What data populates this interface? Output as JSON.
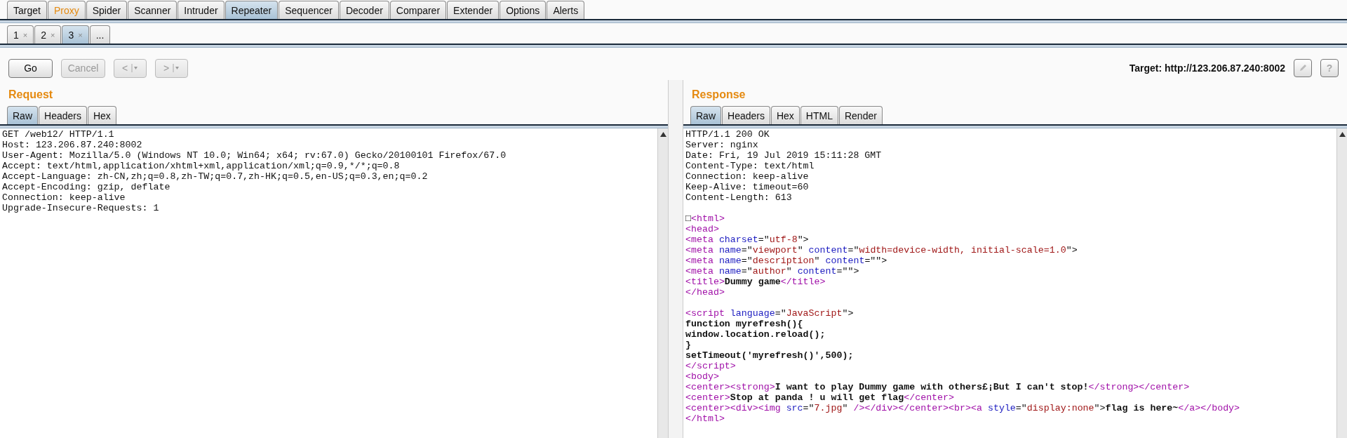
{
  "tabs": [
    {
      "label": "Target",
      "selected": false,
      "highlighted": false
    },
    {
      "label": "Proxy",
      "selected": false,
      "highlighted": true
    },
    {
      "label": "Spider",
      "selected": false,
      "highlighted": false
    },
    {
      "label": "Scanner",
      "selected": false,
      "highlighted": false
    },
    {
      "label": "Intruder",
      "selected": false,
      "highlighted": false
    },
    {
      "label": "Repeater",
      "selected": true,
      "highlighted": false
    },
    {
      "label": "Sequencer",
      "selected": false,
      "highlighted": false
    },
    {
      "label": "Decoder",
      "selected": false,
      "highlighted": false
    },
    {
      "label": "Comparer",
      "selected": false,
      "highlighted": false
    },
    {
      "label": "Extender",
      "selected": false,
      "highlighted": false
    },
    {
      "label": "Options",
      "selected": false,
      "highlighted": false
    },
    {
      "label": "Alerts",
      "selected": false,
      "highlighted": false
    }
  ],
  "repeater_tabs": [
    {
      "label": "1",
      "close": "×",
      "selected": false
    },
    {
      "label": "2",
      "close": "×",
      "selected": false
    },
    {
      "label": "3",
      "close": "×",
      "selected": true
    }
  ],
  "new_tab": "...",
  "toolbar": {
    "buttons": [
      {
        "label": "Go",
        "kind": "plain",
        "disabled": false
      },
      {
        "label": "Cancel",
        "kind": "plain",
        "disabled": true
      },
      {
        "label": "<",
        "kind": "history",
        "disabled": true
      },
      {
        "label": ">",
        "kind": "history",
        "disabled": true
      }
    ],
    "target": "Target: http://123.206.87.240:8002",
    "help": "?"
  },
  "request": {
    "title": "Request",
    "tabs": [
      {
        "label": "Raw",
        "selected": true
      },
      {
        "label": "Headers",
        "selected": false
      },
      {
        "label": "Hex",
        "selected": false
      }
    ],
    "lines": [
      "GET /web12/ HTTP/1.1",
      "Host: 123.206.87.240:8002",
      "User-Agent: Mozilla/5.0 (Windows NT 10.0; Win64; x64; rv:67.0) Gecko/20100101 Firefox/67.0",
      "Accept: text/html,application/xhtml+xml,application/xml;q=0.9,*/*;q=0.8",
      "Accept-Language: zh-CN,zh;q=0.8,zh-TW;q=0.7,zh-HK;q=0.5,en-US;q=0.3,en;q=0.2",
      "Accept-Encoding: gzip, deflate",
      "Connection: keep-alive",
      "Upgrade-Insecure-Requests: 1"
    ]
  },
  "response": {
    "title": "Response",
    "tabs": [
      {
        "label": "Raw",
        "selected": true
      },
      {
        "label": "Headers",
        "selected": false
      },
      {
        "label": "Hex",
        "selected": false
      },
      {
        "label": "HTML",
        "selected": false
      },
      {
        "label": "Render",
        "selected": false
      }
    ],
    "blocks": [
      {
        "lines": [
          [
            {
              "kind": "plain",
              "text": "HTTP/1.1 200 OK"
            }
          ],
          [
            {
              "kind": "plain",
              "text": "Server: nginx"
            }
          ],
          [
            {
              "kind": "plain",
              "text": "Date: Fri, 19 Jul 2019 15:11:28 GMT"
            }
          ],
          [
            {
              "kind": "plain",
              "text": "Content-Type: text/html"
            }
          ],
          [
            {
              "kind": "plain",
              "text": "Connection: keep-alive"
            }
          ],
          [
            {
              "kind": "plain",
              "text": "Keep-Alive: timeout=60"
            }
          ],
          [
            {
              "kind": "plain",
              "text": "Content-Length: 613"
            }
          ]
        ]
      },
      {
        "lines": [
          [
            {
              "kind": "plain",
              "text": "□"
            },
            {
              "kind": "tag",
              "text": "<html>"
            }
          ],
          [
            {
              "kind": "tag",
              "text": "<head>"
            }
          ],
          [
            {
              "kind": "tag",
              "text": "<meta "
            },
            {
              "kind": "attr",
              "text": "charset"
            },
            {
              "kind": "plain",
              "text": "=\""
            },
            {
              "kind": "value",
              "text": "utf-8"
            },
            {
              "kind": "plain",
              "text": "\">"
            }
          ],
          [
            {
              "kind": "tag",
              "text": "<meta "
            },
            {
              "kind": "attr",
              "text": "name"
            },
            {
              "kind": "plain",
              "text": "=\""
            },
            {
              "kind": "value",
              "text": "viewport"
            },
            {
              "kind": "plain",
              "text": "\" "
            },
            {
              "kind": "attr",
              "text": "content"
            },
            {
              "kind": "plain",
              "text": "=\""
            },
            {
              "kind": "value",
              "text": "width=device-width, initial-scale=1.0"
            },
            {
              "kind": "plain",
              "text": "\">"
            }
          ],
          [
            {
              "kind": "tag",
              "text": "<meta "
            },
            {
              "kind": "attr",
              "text": "name"
            },
            {
              "kind": "plain",
              "text": "=\""
            },
            {
              "kind": "value",
              "text": "description"
            },
            {
              "kind": "plain",
              "text": "\" "
            },
            {
              "kind": "attr",
              "text": "content"
            },
            {
              "kind": "plain",
              "text": "=\"\">"
            }
          ],
          [
            {
              "kind": "tag",
              "text": "<meta "
            },
            {
              "kind": "attr",
              "text": "name"
            },
            {
              "kind": "plain",
              "text": "=\""
            },
            {
              "kind": "value",
              "text": "author"
            },
            {
              "kind": "plain",
              "text": "\" "
            },
            {
              "kind": "attr",
              "text": "content"
            },
            {
              "kind": "plain",
              "text": "=\"\">"
            }
          ],
          [
            {
              "kind": "tag",
              "text": "<title>"
            },
            {
              "kind": "text",
              "text": "Dummy game"
            },
            {
              "kind": "tag",
              "text": "</title>"
            }
          ],
          [
            {
              "kind": "tag",
              "text": "</head>"
            }
          ]
        ]
      },
      {
        "lines": [
          [
            {
              "kind": "tag",
              "text": "<script "
            },
            {
              "kind": "attr",
              "text": "language"
            },
            {
              "kind": "plain",
              "text": "=\""
            },
            {
              "kind": "value",
              "text": "JavaScript"
            },
            {
              "kind": "plain",
              "text": "\">"
            }
          ],
          [
            {
              "kind": "text",
              "text": "function myrefresh(){"
            }
          ],
          [
            {
              "kind": "text",
              "text": "window.location.reload();"
            }
          ],
          [
            {
              "kind": "text",
              "text": "}"
            }
          ],
          [
            {
              "kind": "text",
              "text": "setTimeout('myrefresh()',500);"
            }
          ],
          [
            {
              "kind": "tag",
              "text": "</script>"
            }
          ],
          [
            {
              "kind": "tag",
              "text": "<body>"
            }
          ],
          [
            {
              "kind": "tag",
              "text": "<center><strong>"
            },
            {
              "kind": "text",
              "text": "I want to play Dummy game with others£¡But I can't stop!"
            },
            {
              "kind": "tag",
              "text": "</strong></center>"
            }
          ],
          [
            {
              "kind": "tag",
              "text": "<center>"
            },
            {
              "kind": "text",
              "text": "Stop at panda ! u will get flag"
            },
            {
              "kind": "tag",
              "text": "</center>"
            }
          ],
          [
            {
              "kind": "tag",
              "text": "<center><div><img "
            },
            {
              "kind": "attr",
              "text": "src"
            },
            {
              "kind": "plain",
              "text": "=\""
            },
            {
              "kind": "value",
              "text": "7.jpg"
            },
            {
              "kind": "plain",
              "text": "\" "
            },
            {
              "kind": "tag",
              "text": "/></div></center><br><a "
            },
            {
              "kind": "attr",
              "text": "style"
            },
            {
              "kind": "plain",
              "text": "=\""
            },
            {
              "kind": "value",
              "text": "display:none"
            },
            {
              "kind": "plain",
              "text": "\">"
            },
            {
              "kind": "text",
              "text": "flag is here~"
            },
            {
              "kind": "tag",
              "text": "</a></body>"
            }
          ],
          [
            {
              "kind": "tag",
              "text": "</html>"
            }
          ]
        ]
      }
    ]
  }
}
